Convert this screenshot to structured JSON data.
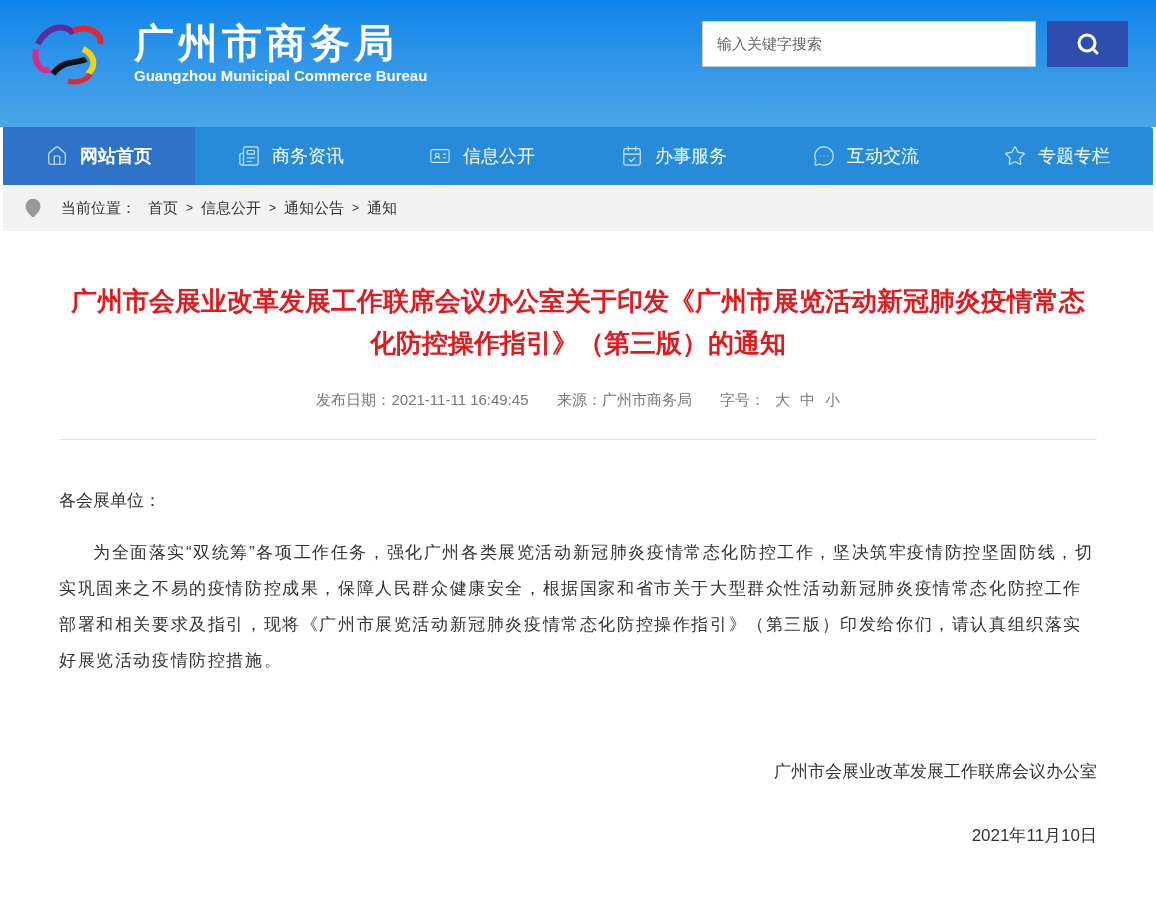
{
  "header": {
    "site_name": "广州市商务局",
    "site_name_en": "Guangzhou Municipal Commerce Bureau",
    "search": {
      "placeholder": "输入关键字搜索"
    }
  },
  "nav": [
    {
      "label": "网站首页",
      "selected": true
    },
    {
      "label": "商务资讯",
      "selected": false
    },
    {
      "label": "信息公开",
      "selected": false
    },
    {
      "label": "办事服务",
      "selected": false
    },
    {
      "label": "互动交流",
      "selected": false
    },
    {
      "label": "专题专栏",
      "selected": false
    }
  ],
  "breadcrumb": {
    "label": "当前位置：",
    "items": [
      "首页",
      "信息公开",
      "通知公告",
      "通知"
    ],
    "separator": ">"
  },
  "article": {
    "title": "广州市会展业改革发展工作联席会议办公室关于印发《广州市展览活动新冠肺炎疫情常态化防控操作指引》（第三版）的通知",
    "meta": {
      "date": "发布日期：2021-11-11 16:49:45",
      "source": "来源：广州市商务局",
      "font_size_label": "字号：",
      "font_sizes": [
        "大",
        "中",
        "小"
      ]
    },
    "salutation": "各会展单位：",
    "paragraphs": [
      "为全面落实“双统筹”各项工作任务，强化广州各类展览活动新冠肺炎疫情常态化防控工作，坚决筑牢疫情防控坚固防线，切实巩固来之不易的疫情防控成果，保障人民群众健康安全，根据国家和省市关于大型群众性活动新冠肺炎疫情常态化防控工作部署和相关要求及指引，现将《广州市展览活动新冠肺炎疫情常态化防控操作指引》（第三版）印发给你们，请认真组织落实好展览活动疫情防控措施。"
    ],
    "signature": "广州市会展业改革发展工作联席会议办公室",
    "sign_date": "2021年11月10日"
  }
}
